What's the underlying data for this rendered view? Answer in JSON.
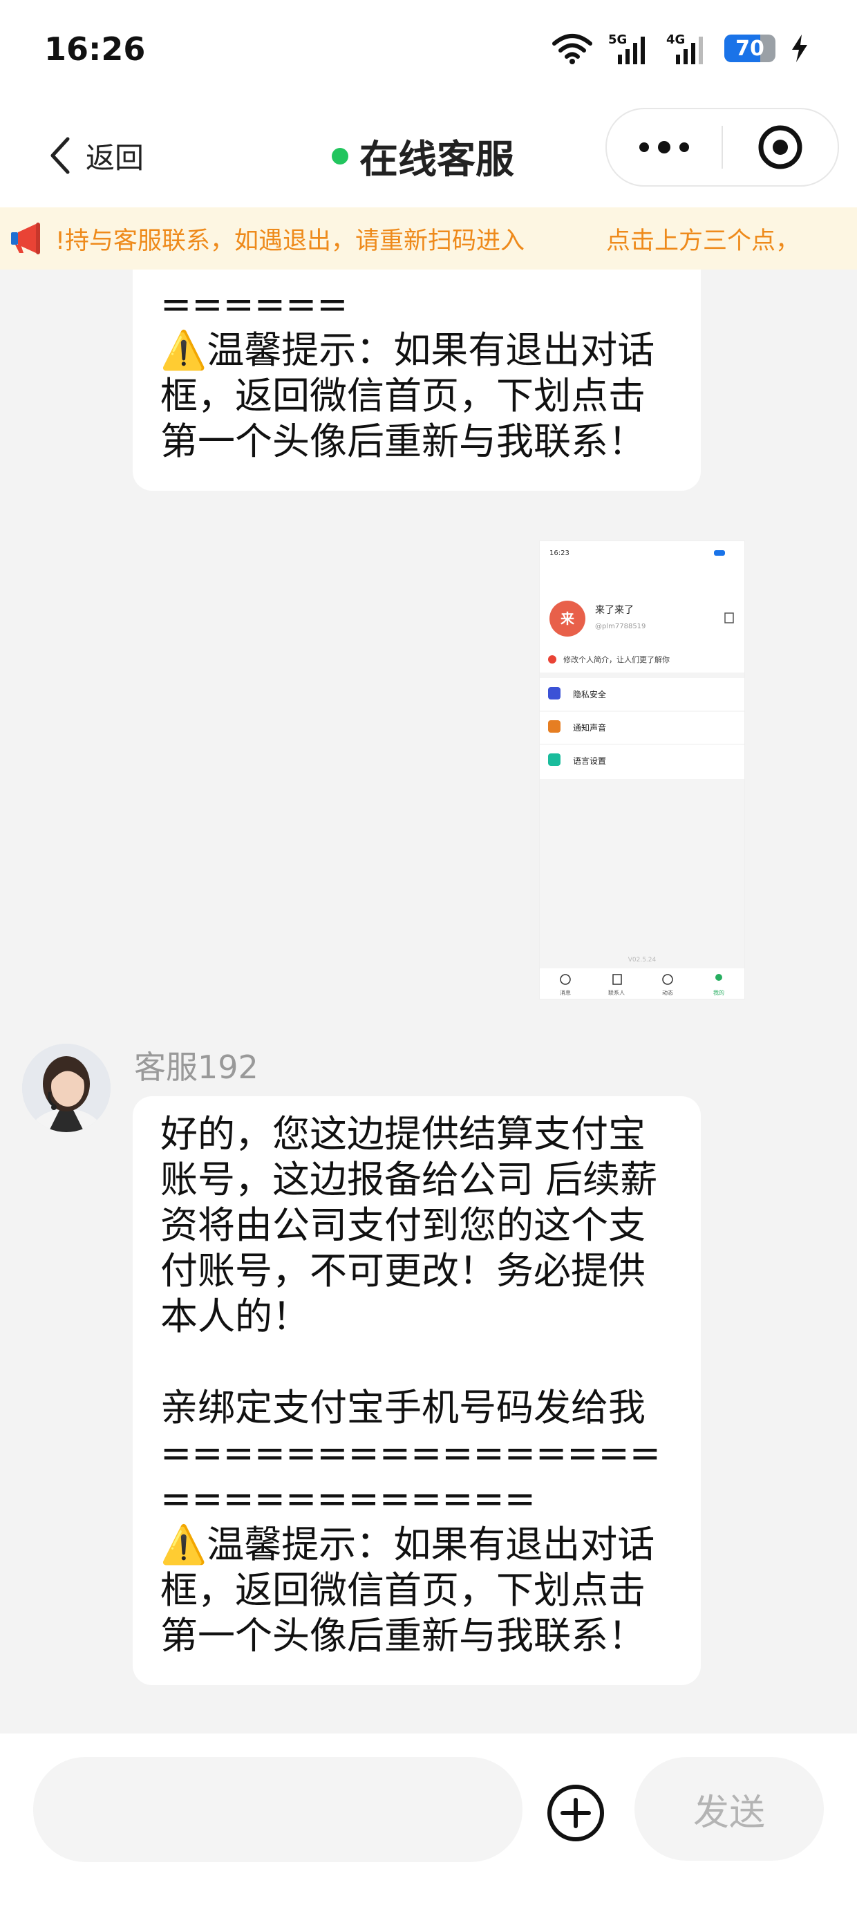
{
  "status_bar": {
    "time": "16:26",
    "net1": "5G",
    "net2": "4G",
    "battery": "70",
    "battery_level": 0.7
  },
  "nav": {
    "back_label": "返回",
    "title": "在线客服",
    "online_color": "#22c55e"
  },
  "notice": {
    "text_a": "!持与客服联系，如遇退出，请重新扫码进入",
    "text_b": "点击上方三个点，",
    "color": "#ee8a1b"
  },
  "messages": [
    {
      "text": "======\n⚠️温馨提示：如果有退出对话框，返回微信首页，下划点击第一个头像后重新与我联系！"
    },
    {
      "sender": "客服192",
      "text": "好的，您这边提供结算支付宝账号，这边报备给公司 后续薪资将由公司支付到您的这个支付账号，不可更改！务必提供本人的！\n\n亲绑定支付宝手机号码发给我============================\n⚠️温馨提示：如果有退出对话框，返回微信首页，下划点击第一个头像后重新与我联系！"
    }
  ],
  "screenshot": {
    "time": "16:23",
    "avatar_char": "来",
    "name": "来了来了",
    "handle": "@plm7788519",
    "tip": "修改个人简介，让人们更了解你",
    "menu": [
      "隐私安全",
      "通知声音",
      "语言设置"
    ],
    "version": "V02.5.24",
    "tabs": [
      "消息",
      "联系人",
      "动态",
      "我的"
    ]
  },
  "composer": {
    "input_value": "",
    "send_label": "发送"
  }
}
